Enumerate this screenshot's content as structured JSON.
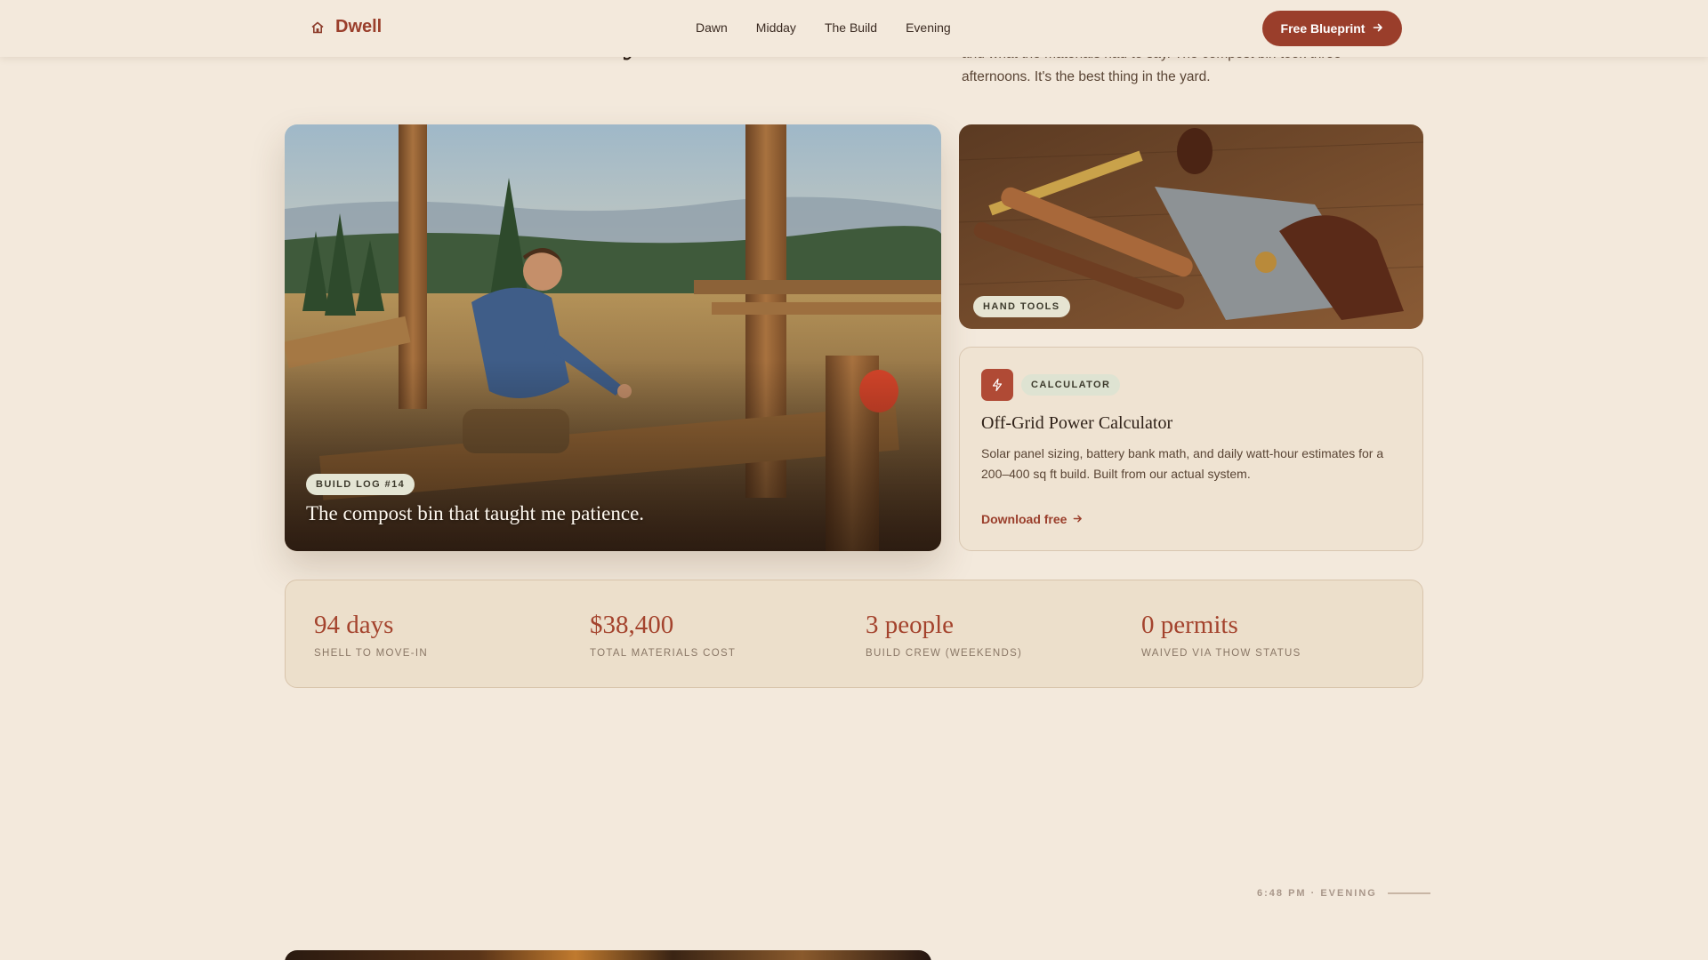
{
  "nav": {
    "brand": "Dwell",
    "links": [
      "Dawn",
      "Midday",
      "The Build",
      "Evening"
    ],
    "cta_label": "Free Blueprint"
  },
  "intro": {
    "title_fragment": "y",
    "paragraph_lines": [
      "and what the materials had to say. The compost bin took three",
      "afternoons. It's the best thing in the yard."
    ]
  },
  "hero_card": {
    "badge": "BUILD LOG #14",
    "caption": "The compost bin that taught me patience."
  },
  "tools_card": {
    "badge": "HAND TOOLS"
  },
  "calculator_card": {
    "badge": "CALCULATOR",
    "title": "Off-Grid Power Calculator",
    "description": "Solar panel sizing, battery bank math, and daily watt-hour estimates for a 200–400 sq ft build. Built from our actual system.",
    "link_label": "Download free"
  },
  "stats": [
    {
      "value": "94 days",
      "label": "SHELL TO MOVE-IN"
    },
    {
      "value": "$38,400",
      "label": "TOTAL MATERIALS COST"
    },
    {
      "value": "3 people",
      "label": "BUILD CREW (WEEKENDS)"
    },
    {
      "value": "0 permits",
      "label": "WAIVED VIA THOW STATUS"
    }
  ],
  "section_marker": "6:48 PM · EVENING",
  "colors": {
    "accent": "#9a3e2b",
    "background": "#f3e9dc",
    "badge_bg": "#e4e5d4"
  },
  "icons": {
    "brand": "house-icon",
    "cta": "arrow-right-icon",
    "calculator": "lightning-icon",
    "download": "arrow-right-icon"
  }
}
